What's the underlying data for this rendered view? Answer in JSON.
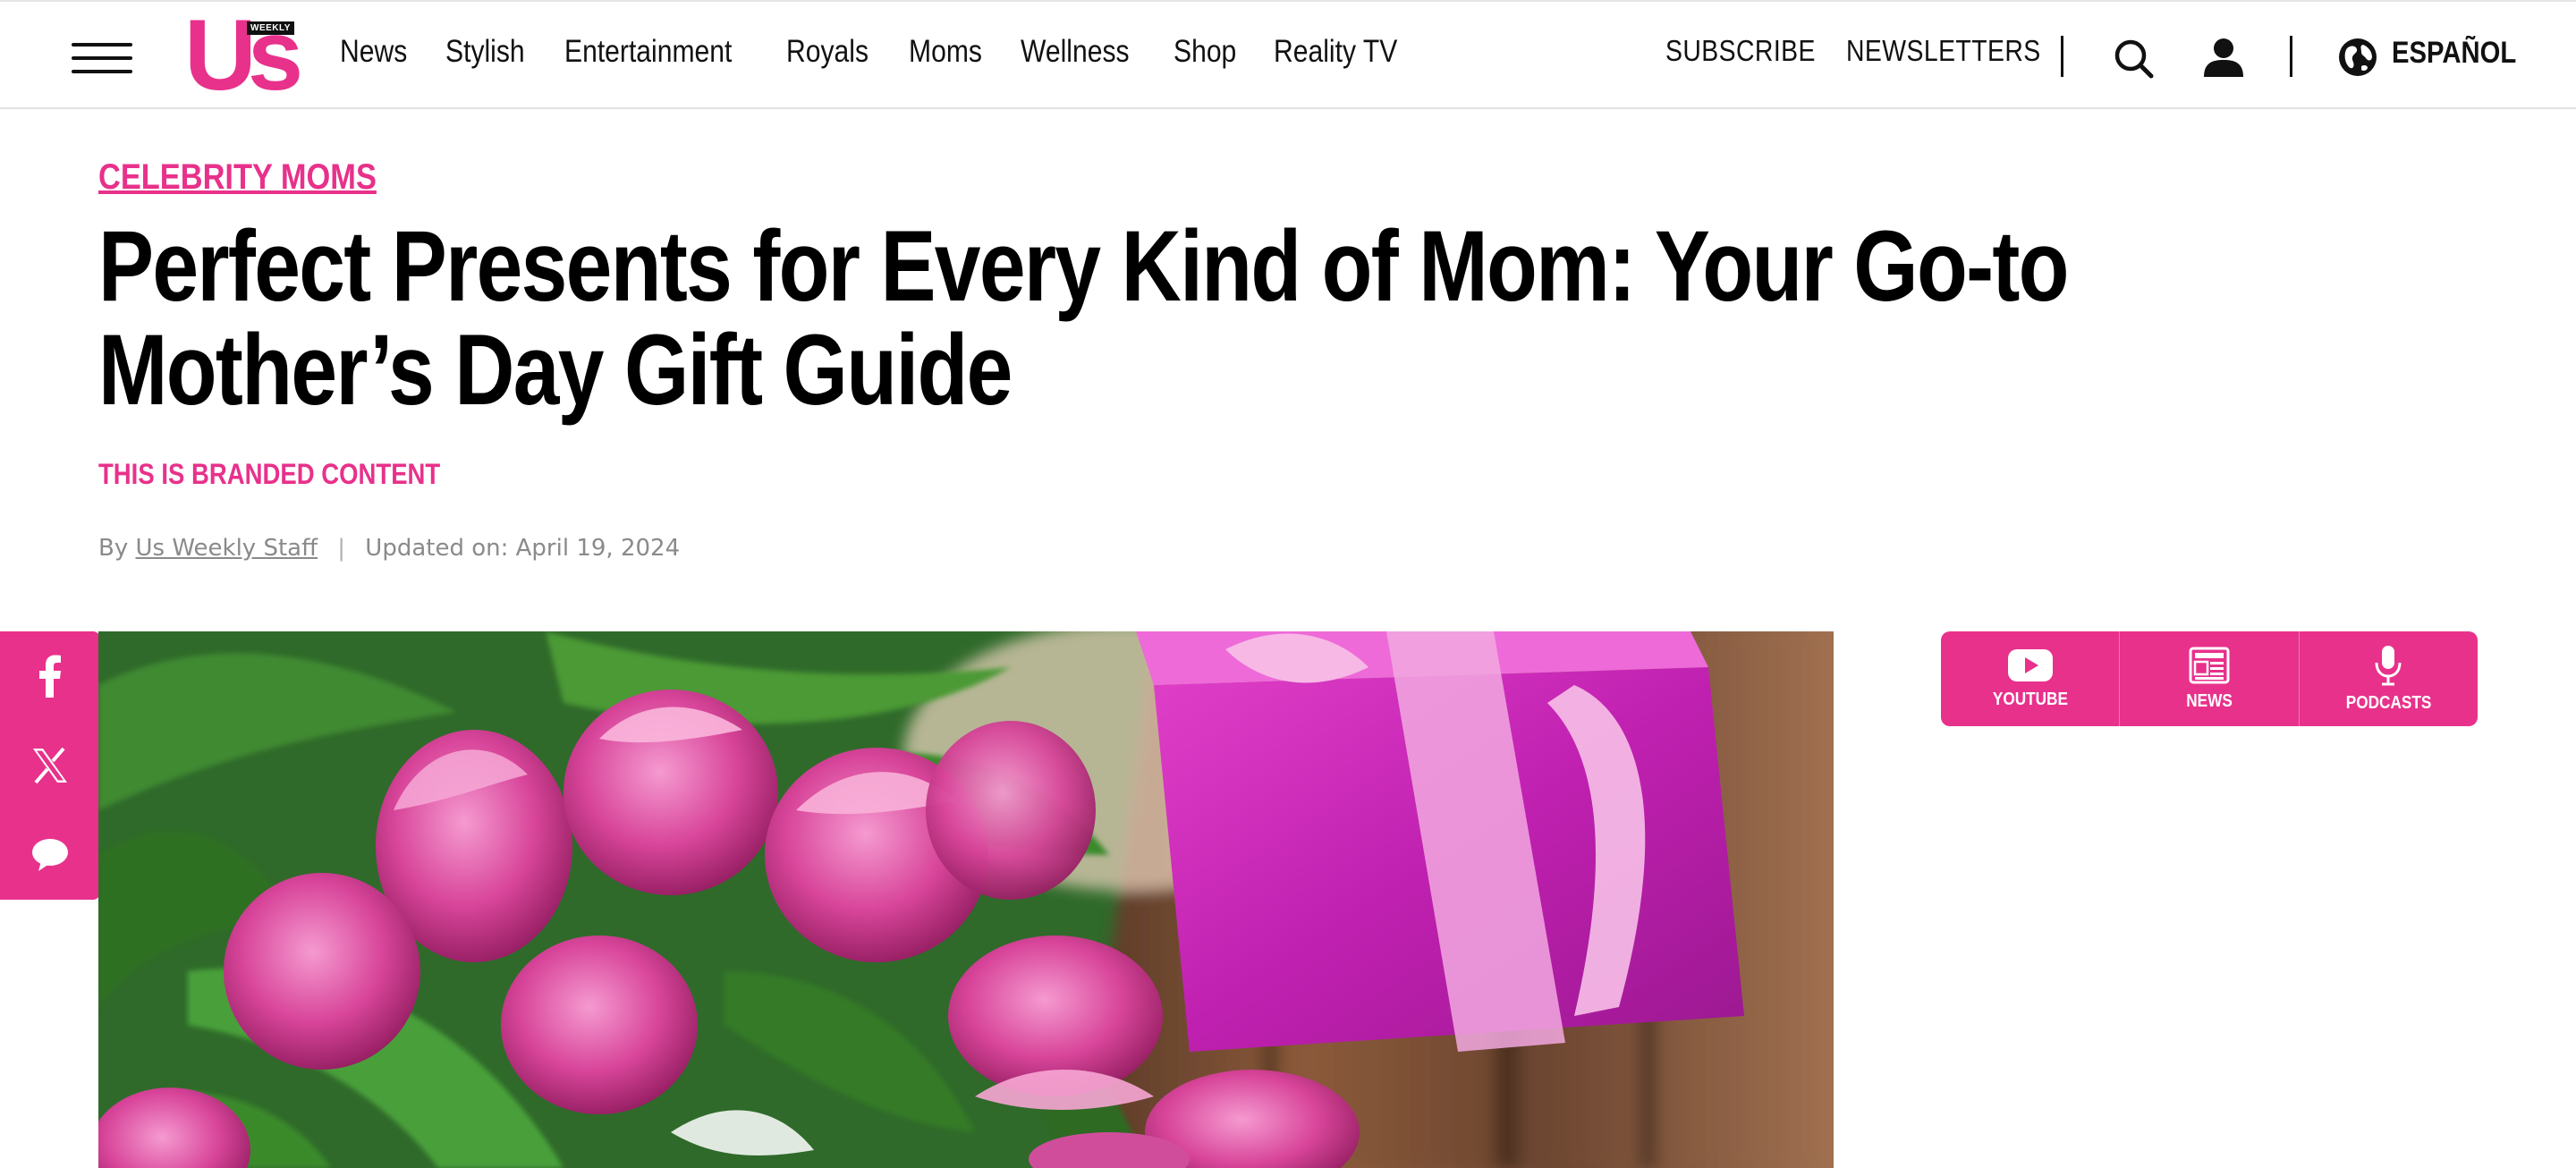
{
  "header": {
    "logo": {
      "text": "Us",
      "tag": "WEEKLY"
    },
    "nav": [
      "News",
      "Stylish",
      "Entertainment",
      "Royals",
      "Moms",
      "Wellness",
      "Shop",
      "Reality TV"
    ],
    "subscribe": "SUBSCRIBE",
    "newsletters": "NEWSLETTERS",
    "language": "ESPAÑOL"
  },
  "article": {
    "category": "CELEBRITY MOMS",
    "title": "Perfect Presents for Every Kind of Mom: Your Go-to Mother’s Day Gift Guide",
    "branded": "THIS IS BRANDED CONTENT",
    "byline_prefix": "By",
    "author": "Us Weekly Staff",
    "separator": "|",
    "updated": "Updated on: April 19, 2024"
  },
  "social": [
    "facebook-icon",
    "x-icon",
    "comment-icon"
  ],
  "media": {
    "items": [
      {
        "label": "YOUTUBE",
        "icon": "youtube-icon"
      },
      {
        "label": "NEWS",
        "icon": "newspaper-icon"
      },
      {
        "label": "PODCASTS",
        "icon": "microphone-icon"
      }
    ]
  },
  "colors": {
    "brand": "#e8318b",
    "text": "#000000",
    "muted": "#8a8a8a"
  }
}
